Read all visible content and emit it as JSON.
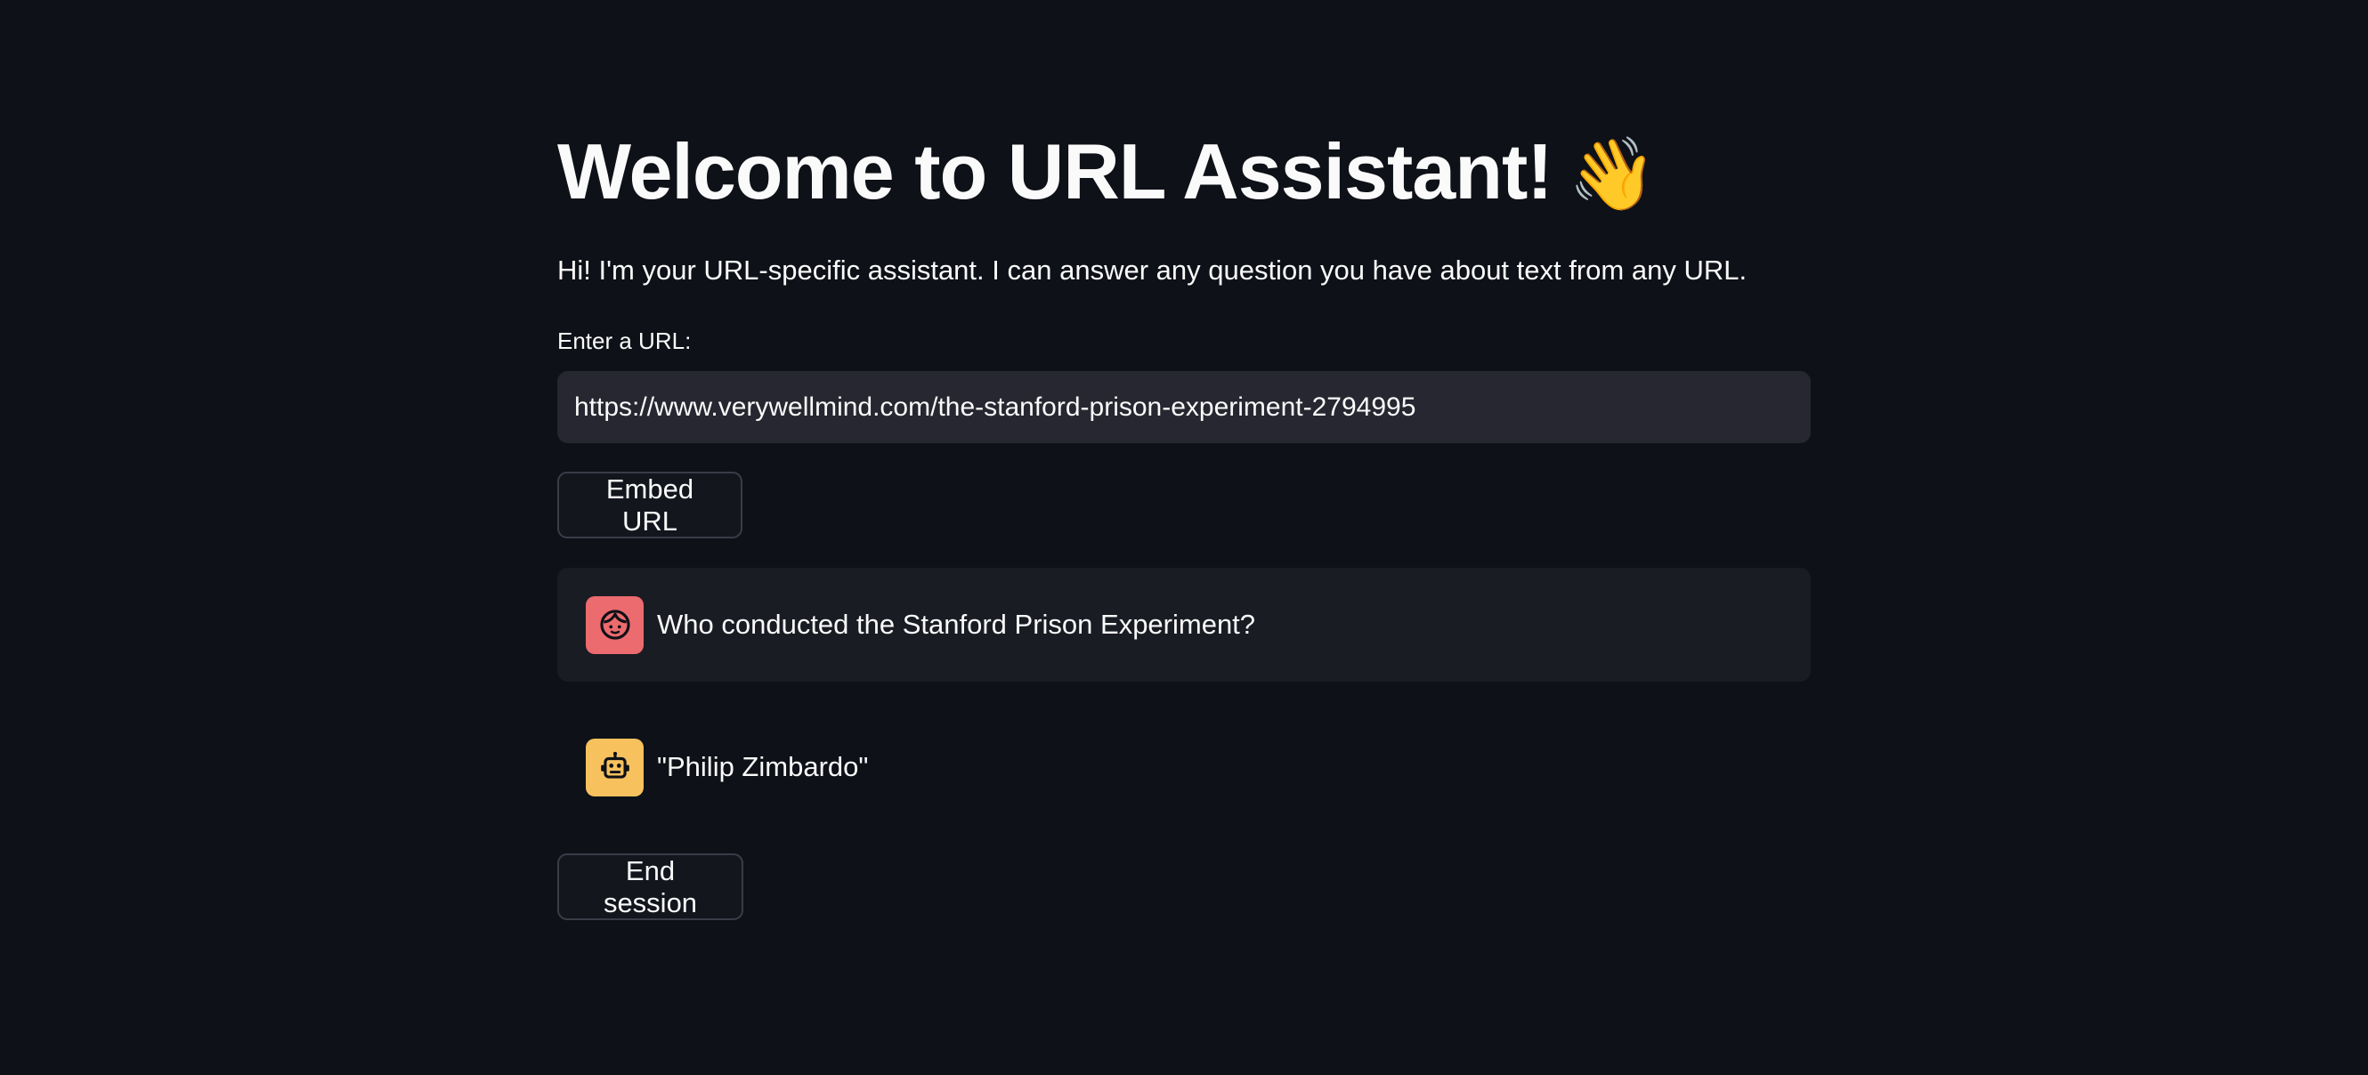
{
  "header": {
    "title": "Welcome to URL Assistant!",
    "title_emoji": "👋",
    "intro": "Hi! I'm your URL-specific assistant. I can answer any question you have about text from any URL."
  },
  "url_form": {
    "label": "Enter a URL:",
    "value": "https://www.verywellmind.com/the-stanford-prison-experiment-2794995",
    "embed_button_label": "Embed URL"
  },
  "chat": {
    "messages": [
      {
        "role": "user",
        "avatar_icon": "user-face-icon",
        "avatar_color": "#ec6b6e",
        "text": "Who conducted the Stanford Prison Experiment?"
      },
      {
        "role": "assistant",
        "avatar_icon": "robot-icon",
        "avatar_color": "#f7c15e",
        "text": "\"Philip Zimbardo\""
      }
    ]
  },
  "actions": {
    "end_session_label": "End session"
  },
  "colors": {
    "background": "#0e1117",
    "input_background": "#262730",
    "user_message_background": "#1a1c24",
    "text": "#fafafa"
  }
}
